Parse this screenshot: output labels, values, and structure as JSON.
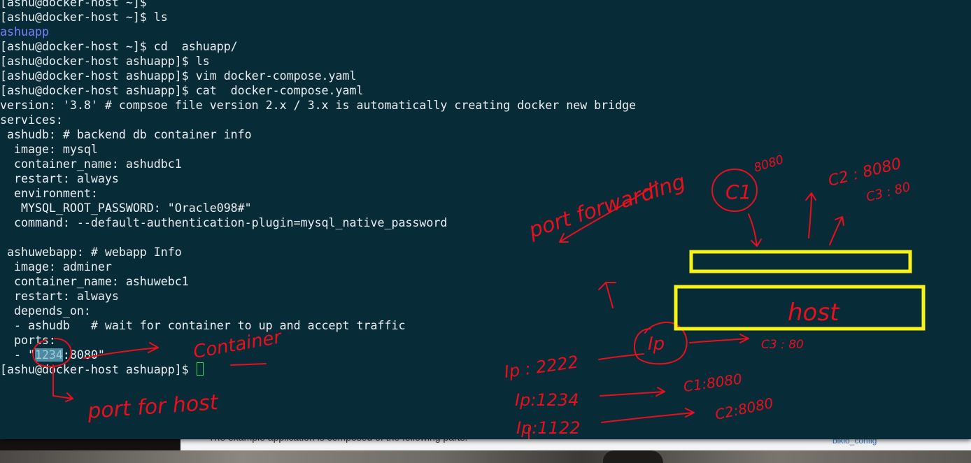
{
  "terminal": {
    "lines": [
      {
        "type": "prompt",
        "text": "[ashu@docker-host ~]$"
      },
      {
        "type": "prompt",
        "text": "[ashu@docker-host ~]$ ls"
      },
      {
        "type": "dir",
        "text": "ashuapp"
      },
      {
        "type": "prompt",
        "text": "[ashu@docker-host ~]$ cd  ashuapp/"
      },
      {
        "type": "prompt",
        "text": "[ashu@docker-host ashuapp]$ ls"
      },
      {
        "type": "prompt",
        "text": "[ashu@docker-host ashuapp]$ vim docker-compose.yaml"
      },
      {
        "type": "prompt",
        "text": "[ashu@docker-host ashuapp]$ cat  docker-compose.yaml"
      },
      {
        "type": "out",
        "text": "version: '3.8' # compsoe file version 2.x / 3.x is automatically creating docker new bridge"
      },
      {
        "type": "out",
        "text": "services:"
      },
      {
        "type": "out",
        "text": " ashudb: # backend db container info"
      },
      {
        "type": "out",
        "text": "  image: mysql"
      },
      {
        "type": "out",
        "text": "  container_name: ashudbc1"
      },
      {
        "type": "out",
        "text": "  restart: always"
      },
      {
        "type": "out",
        "text": "  environment:"
      },
      {
        "type": "out",
        "text": "   MYSQL_ROOT_PASSWORD: \"Oracle098#\""
      },
      {
        "type": "out",
        "text": "  command: --default-authentication-plugin=mysql_native_password"
      },
      {
        "type": "out",
        "text": ""
      },
      {
        "type": "out",
        "text": " ashuwebapp: # webapp Info"
      },
      {
        "type": "out",
        "text": "  image: adminer"
      },
      {
        "type": "out",
        "text": "  container_name: ashuwebc1"
      },
      {
        "type": "out",
        "text": "  restart: always"
      },
      {
        "type": "out",
        "text": "  depends_on:"
      },
      {
        "type": "out",
        "text": "  - ashudb   # wait for container to up and accept traffic"
      },
      {
        "type": "out",
        "text": "  ports:"
      }
    ],
    "ports_line": {
      "prefix": "  - \"",
      "selected": "1234",
      "suffix": ":8080\""
    },
    "final_prompt": "[ashu@docker-host ashuapp]$ "
  },
  "annotations": {
    "port_forwarding": "port forwarding",
    "container": "Container",
    "port_for_host": "port for host",
    "c1": "C1",
    "c1_port": "8080",
    "c2_top": "C2 : 8080",
    "c3_top": "C3 : 80",
    "host": "host",
    "ip": "Ip",
    "c3_mid": "C3 : 80",
    "ip_2222": "Ip : 2222",
    "ip_1234": "Ip:1234",
    "ip_1122": "Ip:1122",
    "c1_8080": "C1:8080",
    "c2_8080": "C2:8080"
  },
  "background": {
    "page_text": "The example application is composed of the following parts:",
    "page_link": "bikio_config"
  },
  "colors": {
    "terminal_bg": "#082b38",
    "terminal_fg": "#eceff1",
    "dir": "#7d7dff",
    "cursor": "#33e04a",
    "ink": "#e8101c",
    "highlight_box": "#f7f21a"
  }
}
